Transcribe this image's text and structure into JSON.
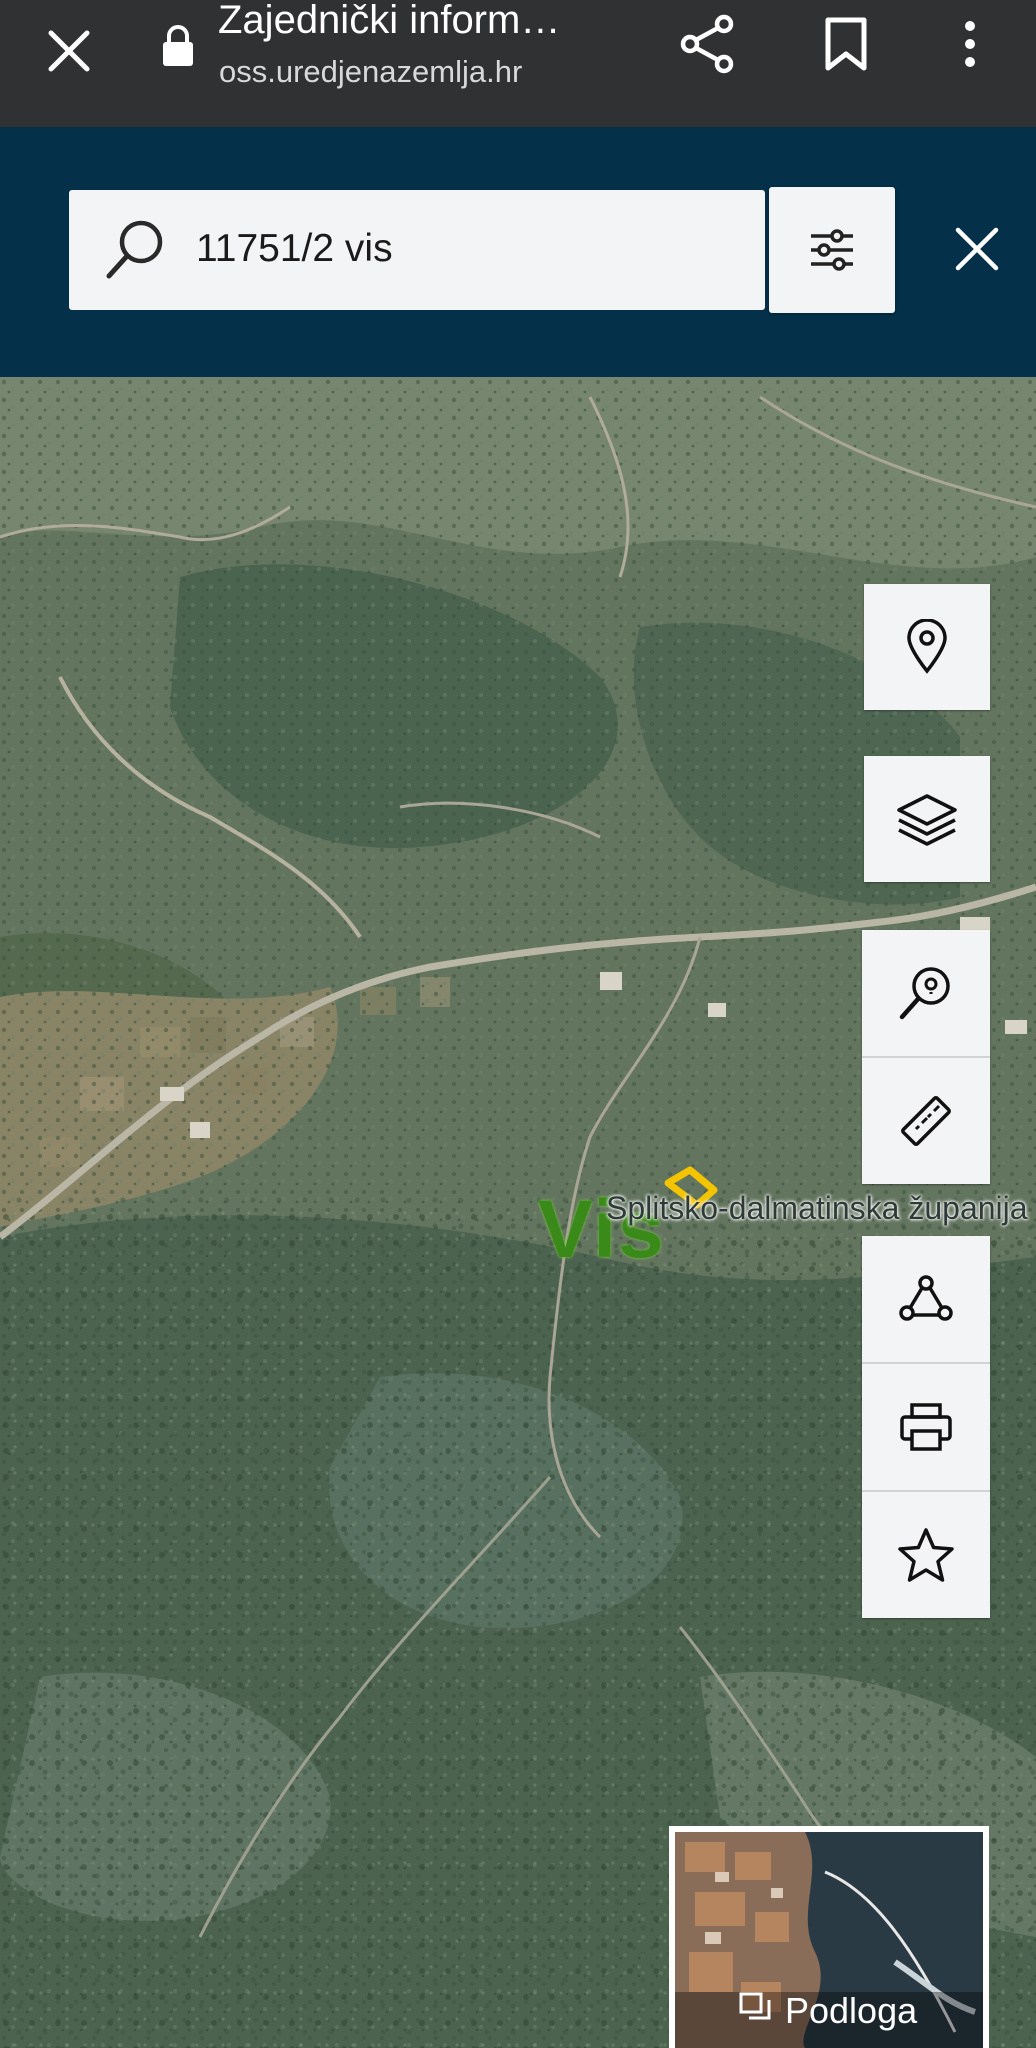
{
  "browser": {
    "title": "Zajednički inform…",
    "url": "oss.uredjenazemlja.hr",
    "icons": [
      "close-icon",
      "lock-icon",
      "share-icon",
      "bookmark-icon",
      "more-vert-icon"
    ]
  },
  "search": {
    "value": "11751/2 vis",
    "icons": [
      "search-icon",
      "filter-sliders-icon",
      "close-icon"
    ]
  },
  "map": {
    "place_label": "Vis",
    "county_label": "Splitsko-dalmatinska županija",
    "parcel_color": "#f5c400",
    "tools": [
      "location-pin-icon",
      "layers-icon",
      "search-location-icon",
      "ruler-icon",
      "polygon-icon",
      "print-icon",
      "star-icon"
    ],
    "basemap_label": "Podloga",
    "basemap_icon": "basemap-icon"
  },
  "colors": {
    "topbar": "#2f3133",
    "header": "#053049",
    "button_bg": "#f3f4f5"
  }
}
